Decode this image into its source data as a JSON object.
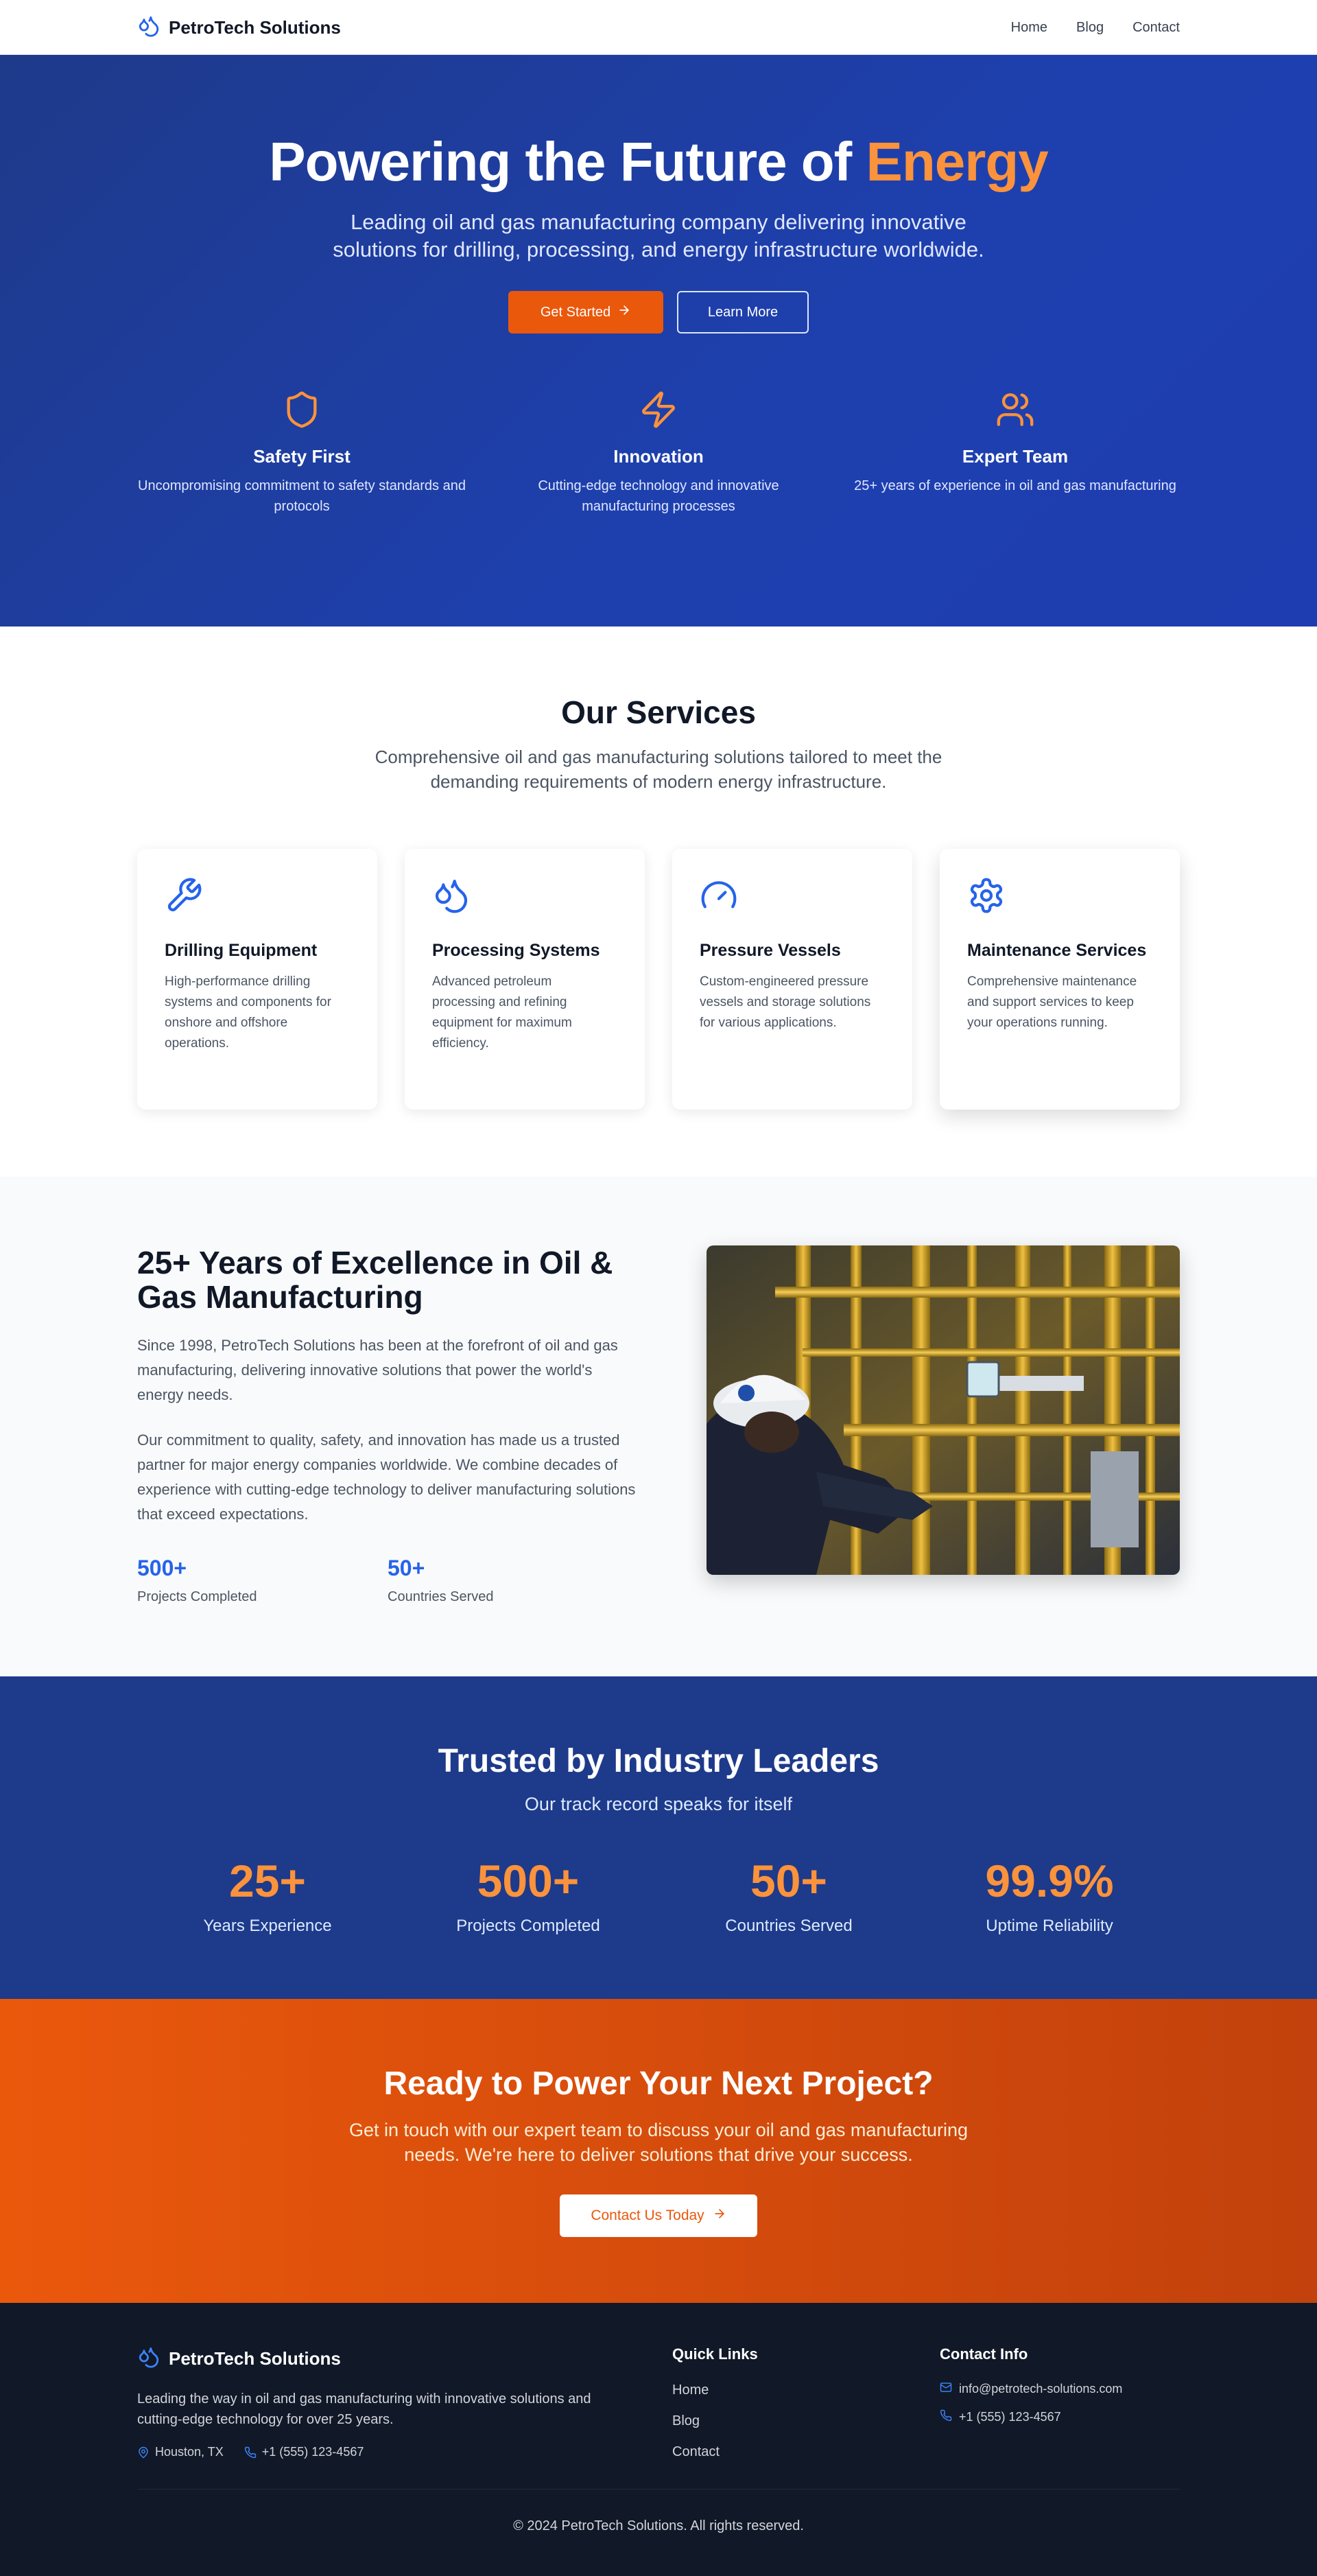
{
  "nav": {
    "brand": "PetroTech Solutions",
    "links": [
      "Home",
      "Blog",
      "Contact"
    ]
  },
  "hero": {
    "title_main": "Powering the Future of ",
    "title_accent": "Energy",
    "lead": "Leading oil and gas manufacturing company delivering innovative solutions for drilling, processing, and energy infrastructure worldwide.",
    "primary_button": "Get Started",
    "secondary_button": "Learn More",
    "features": [
      {
        "icon": "shield-icon",
        "title": "Safety First",
        "desc": "Uncompromising commitment to safety standards and protocols"
      },
      {
        "icon": "lightning-icon",
        "title": "Innovation",
        "desc": "Cutting-edge technology and innovative manufacturing processes"
      },
      {
        "icon": "users-icon",
        "title": "Expert Team",
        "desc": "25+ years of experience in oil and gas manufacturing"
      }
    ]
  },
  "services": {
    "title": "Our Services",
    "subtitle": "Comprehensive oil and gas manufacturing solutions tailored to meet the demanding requirements of modern energy infrastructure.",
    "cards": [
      {
        "icon": "wrench-icon",
        "title": "Drilling Equipment",
        "desc": "High-performance drilling systems and components for onshore and offshore operations."
      },
      {
        "icon": "droplets-icon",
        "title": "Processing Systems",
        "desc": "Advanced petroleum processing and refining equipment for maximum efficiency."
      },
      {
        "icon": "gauge-icon",
        "title": "Pressure Vessels",
        "desc": "Custom-engineered pressure vessels and storage solutions for various applications."
      },
      {
        "icon": "gear-icon",
        "title": "Maintenance Services",
        "desc": "Comprehensive maintenance and support services to keep your operations running."
      }
    ]
  },
  "about": {
    "title": "25+ Years of Excellence in Oil & Gas Manufacturing",
    "para1": "Since 1998, PetroTech Solutions has been at the forefront of oil and gas manufacturing, delivering innovative solutions that power the world's energy needs.",
    "para2": "Our commitment to quality, safety, and innovation has made us a trusted partner for major energy companies worldwide. We combine decades of experience with cutting-edge technology to deliver manufacturing solutions that exceed expectations.",
    "stats": [
      {
        "num": "500+",
        "label": "Projects Completed"
      },
      {
        "num": "50+",
        "label": "Countries Served"
      }
    ]
  },
  "stats": {
    "title": "Trusted by Industry Leaders",
    "subtitle": "Our track record speaks for itself",
    "items": [
      {
        "num": "25+",
        "label": "Years Experience"
      },
      {
        "num": "500+",
        "label": "Projects Completed"
      },
      {
        "num": "50+",
        "label": "Countries Served"
      },
      {
        "num": "99.9%",
        "label": "Uptime Reliability"
      }
    ]
  },
  "cta": {
    "title": "Ready to Power Your Next Project?",
    "text": "Get in touch with our expert team to discuss your oil and gas manufacturing needs. We're here to deliver solutions that drive your success.",
    "button": "Contact Us Today"
  },
  "footer": {
    "brand": "PetroTech Solutions",
    "about": "Leading the way in oil and gas manufacturing with innovative solutions and cutting-edge technology for over 25 years.",
    "location": "Houston, TX",
    "phone": "+1 (555) 123-4567",
    "quick_links_title": "Quick Links",
    "quick_links": [
      "Home",
      "Blog",
      "Contact"
    ],
    "contact_title": "Contact Info",
    "email": "info@petrotech-solutions.com",
    "contact_phone": "+1 (555) 123-4567",
    "copyright": "© 2024 PetroTech Solutions. All rights reserved."
  },
  "colors": {
    "primary_blue": "#1e3a8a",
    "accent_orange": "#ea580c",
    "accent_orange_light": "#fb923c",
    "link_blue": "#2563eb",
    "footer_bg": "#111827"
  }
}
